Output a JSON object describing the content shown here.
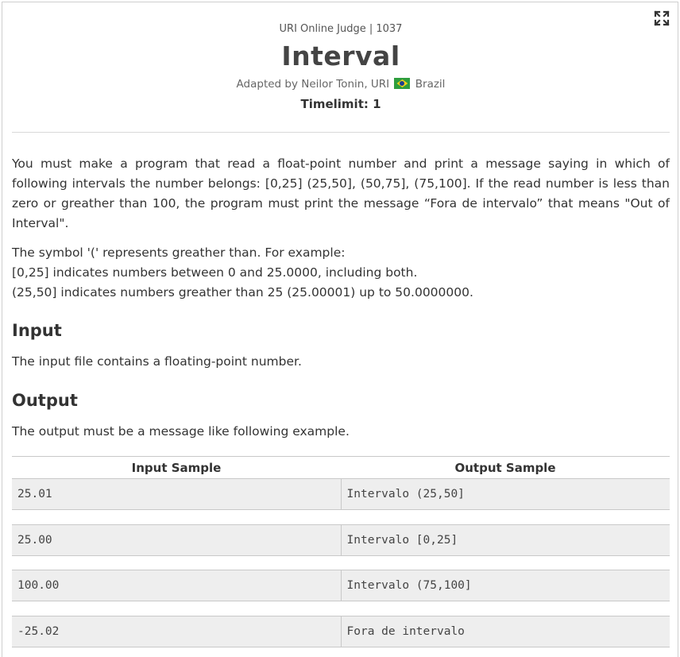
{
  "header": {
    "judge": "URI Online Judge | 1037",
    "title": "Interval",
    "adapted_prefix": "Adapted by Neilor Tonin, URI",
    "adapted_country": "Brazil",
    "flag_icon": "brazil-flag-icon",
    "timelimit": "Timelimit: 1"
  },
  "toolbar": {
    "expand_icon": "fullscreen-expand-icon"
  },
  "description": {
    "paragraph": "You must make a program that read a float-point number and print a message saying in which of following intervals the number belongs: [0,25] (25,50], (50,75], (75,100]. If the read number is less than zero or greather than 100, the program must print the message “Fora de intervalo” that means \"Out of Interval\".",
    "symbol_lines": [
      "The symbol '(' represents greather than. For example:",
      "[0,25] indicates numbers between 0 and 25.0000, including both.",
      "(25,50] indicates numbers greather than 25 (25.00001) up to 50.0000000."
    ]
  },
  "input": {
    "heading": "Input",
    "text": "The input file contains a floating-point number."
  },
  "output": {
    "heading": "Output",
    "text": "The output must be a message like following example."
  },
  "samples": {
    "headers": [
      "Input Sample",
      "Output Sample"
    ],
    "rows": [
      {
        "input": "25.01",
        "output": "Intervalo (25,50]"
      },
      {
        "input": "25.00",
        "output": "Intervalo [0,25]"
      },
      {
        "input": "100.00",
        "output": "Intervalo (75,100]"
      },
      {
        "input": "-25.02",
        "output": "Fora de intervalo"
      }
    ]
  },
  "colors": {
    "cell_bg": "#eeeeee",
    "text": "#333333",
    "border": "#c8c8c8"
  }
}
